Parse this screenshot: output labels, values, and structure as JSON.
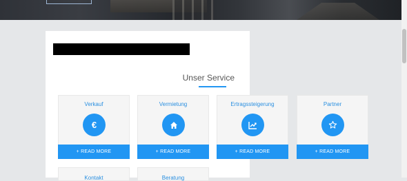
{
  "hero": {
    "button_label": ""
  },
  "section": {
    "title": "Unser Service"
  },
  "services": [
    {
      "title": "Verkauf",
      "icon": "euro-icon",
      "glyph": "€",
      "button": "+ READ MORE"
    },
    {
      "title": "Vermietung",
      "icon": "house-icon",
      "button": "+ READ MORE"
    },
    {
      "title": "Ertragssteigerung",
      "icon": "chart-line-icon",
      "button": "+ READ MORE"
    },
    {
      "title": "Partner",
      "icon": "star-icon",
      "button": "+ READ MORE"
    }
  ],
  "services_row2": [
    {
      "title": "Kontakt"
    },
    {
      "title": "Beratung"
    }
  ],
  "colors": {
    "accent": "#2196f3",
    "page_bg": "#e5e7e9",
    "card_bg": "#f5f5f5"
  }
}
